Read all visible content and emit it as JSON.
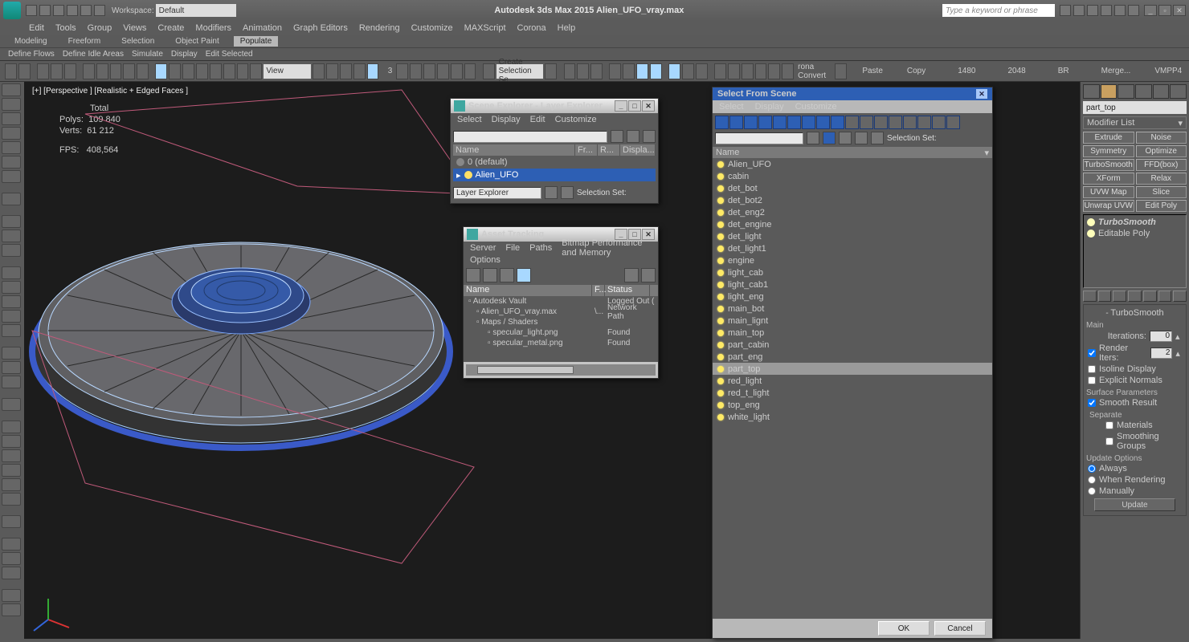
{
  "title": "Autodesk 3ds Max 2015   Alien_UFO_vray.max",
  "workspace": {
    "label": "Workspace:",
    "value": "Default"
  },
  "search_placeholder": "Type a keyword or phrase",
  "menu": [
    "Edit",
    "Tools",
    "Group",
    "Views",
    "Create",
    "Modifiers",
    "Animation",
    "Graph Editors",
    "Rendering",
    "Customize",
    "MAXScript",
    "Corona",
    "Help"
  ],
  "ribbon_tabs": [
    "Modeling",
    "Freeform",
    "Selection",
    "Object Paint",
    "Populate"
  ],
  "ribbon_active": "Populate",
  "ribbon_sub": [
    "Define Flows",
    "Define Idle Areas",
    "Simulate",
    "Display",
    "Edit Selected"
  ],
  "toolbar": {
    "view_label": "View",
    "seltype": "Create Selection Se",
    "rona": "rona Convert",
    "paste": "Paste",
    "copy": "Copy",
    "x": "1480",
    "y": "2048",
    "br": "BR",
    "merge": "Merge...",
    "vmpp": "VMPP4"
  },
  "viewport": {
    "label": "[+] [Perspective ] [Realistic + Edged Faces ]",
    "stats": {
      "total": "Total",
      "polys_l": "Polys:",
      "polys": "109 840",
      "verts_l": "Verts:",
      "verts": "61 212",
      "fps_l": "FPS:",
      "fps": "408,564"
    }
  },
  "scene_explorer": {
    "title": "Scene Explorer - Layer Explorer",
    "menu": [
      "Select",
      "Display",
      "Edit",
      "Customize"
    ],
    "cols": [
      "Name",
      "Fr...",
      "R...",
      "Displa..."
    ],
    "nodes": [
      {
        "name": "0 (default)",
        "sel": false
      },
      {
        "name": "Alien_UFO",
        "sel": true
      }
    ],
    "mode": "Layer Explorer",
    "selset": "Selection Set:"
  },
  "asset": {
    "title": "Asset Tracking",
    "menu": [
      "Server",
      "File",
      "Paths",
      "Bitmap Performance and Memory"
    ],
    "menu2": "Options",
    "cols": [
      "Name",
      "F...",
      "Status"
    ],
    "rows": [
      {
        "name": "Autodesk Vault",
        "status": "Logged Out ("
      },
      {
        "name": "Alien_UFO_vray.max",
        "f": "\\...",
        "status": "Network Path"
      },
      {
        "name": "Maps / Shaders",
        "status": ""
      },
      {
        "name": "specular_light.png",
        "status": "Found"
      },
      {
        "name": "specular_metal.png",
        "status": "Found"
      }
    ]
  },
  "sfs": {
    "title": "Select From Scene",
    "menu": [
      "Select",
      "Display",
      "Customize"
    ],
    "selset": "Selection Set:",
    "name_col": "Name",
    "items": [
      "Alien_UFO",
      "cabin",
      "det_bot",
      "det_bot2",
      "det_eng2",
      "det_engine",
      "det_light",
      "det_light1",
      "engine",
      "light_cab",
      "light_cab1",
      "light_eng",
      "main_bot",
      "main_lignt",
      "main_top",
      "part_cabin",
      "part_eng",
      "part_top",
      "red_light",
      "red_t_light",
      "top_eng",
      "white_light"
    ],
    "selected": "part_top",
    "ok": "OK",
    "cancel": "Cancel"
  },
  "modify": {
    "obj_name": "part_top",
    "modlist": "Modifier List",
    "buttons": [
      "Extrude",
      "Noise",
      "Symmetry",
      "Optimize",
      "TurboSmooth",
      "FFD(box)",
      "XForm",
      "Relax",
      "UVW Map",
      "Slice",
      "Unwrap UVW",
      "Edit Poly"
    ],
    "stack": [
      {
        "name": "TurboSmooth",
        "bold": true
      },
      {
        "name": "Editable Poly",
        "bold": false
      }
    ],
    "rollout_title": "TurboSmooth",
    "group_main": "Main",
    "iterations_l": "Iterations:",
    "iterations": "0",
    "render_iters_l": "Render Iters:",
    "render_iters": "2",
    "isoline": "Isoline Display",
    "explicit": "Explicit Normals",
    "group_surf": "Surface Parameters",
    "smooth_result": "Smooth Result",
    "separate": "Separate",
    "materials": "Materials",
    "smoothing_groups": "Smoothing Groups",
    "group_update": "Update Options",
    "always": "Always",
    "when_render": "When Rendering",
    "manually": "Manually",
    "update": "Update"
  }
}
